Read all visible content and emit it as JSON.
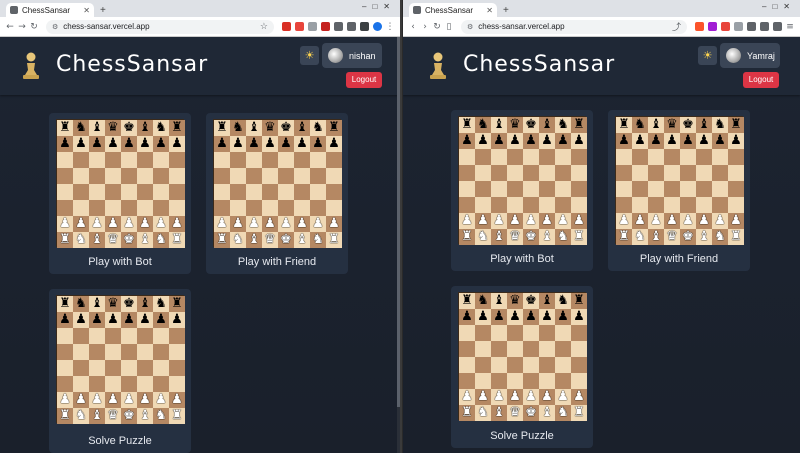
{
  "windows": [
    {
      "tab_title": "ChessSansar",
      "new_tab_icon": "plus-icon",
      "url": "chess-sansar.vercel.app",
      "app": {
        "brand": "ChessSansar",
        "username": "nishan",
        "logout_label": "Logout",
        "theme_icon": "sun-icon",
        "cards": [
          {
            "label": "Play with Bot"
          },
          {
            "label": "Play with Friend"
          },
          {
            "label": "Solve Puzzle"
          }
        ]
      }
    },
    {
      "tab_title": "ChessSansar",
      "new_tab_icon": "plus-icon",
      "url": "chess-sansar.vercel.app",
      "app": {
        "brand": "ChessSansar",
        "username": "Yamraj",
        "logout_label": "Logout",
        "theme_icon": "sun-icon",
        "cards": [
          {
            "label": "Play with Bot"
          },
          {
            "label": "Play with Friend"
          },
          {
            "label": "Solve Puzzle"
          }
        ]
      }
    }
  ],
  "colors": {
    "app_bg": "#1c2431",
    "header_bg": "#1f2836",
    "card_bg": "#253041",
    "logout_bg": "#dc3545",
    "board_light": "#f0d9b5",
    "board_dark": "#b58863"
  },
  "board_rows": [
    "rnbqkbnr",
    "pppppppp",
    "........",
    "........",
    "........",
    "........",
    "PPPPPPPP",
    "RNBQKBNR"
  ]
}
